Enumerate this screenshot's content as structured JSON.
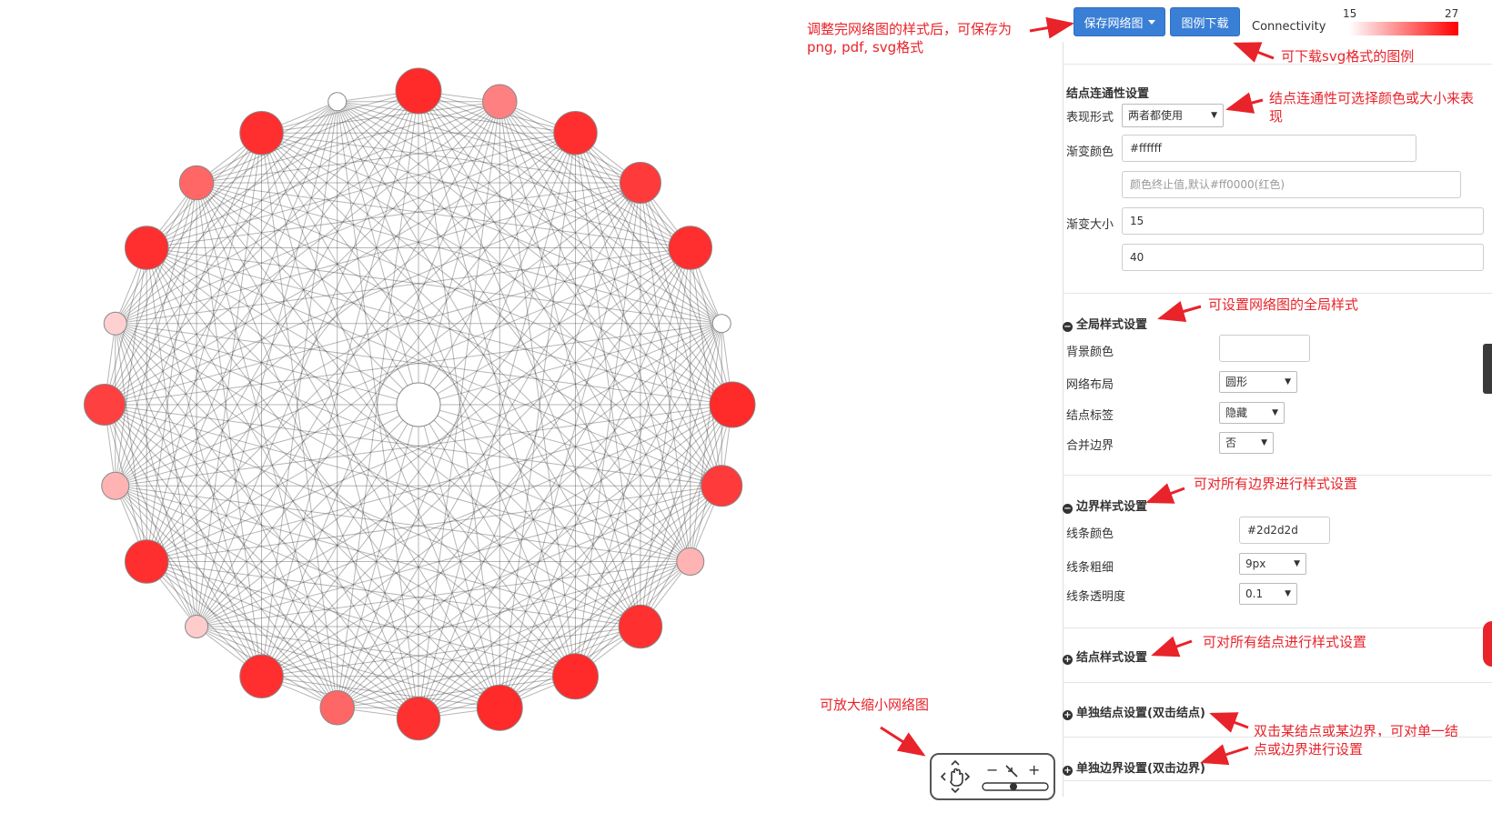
{
  "toolbar": {
    "save_label": "保存网络图",
    "legend_download_label": "图例下载",
    "connectivity_label": "Connectivity",
    "legend_min": "15",
    "legend_max": "27",
    "gradient_start": "#ffffff",
    "gradient_end": "#ff0000"
  },
  "annotations": {
    "save_note_line1": "调整完网络图的样式后，可保存为",
    "save_note_line2": "png, pdf, svg格式",
    "legend_note": "可下载svg格式的图例",
    "connectivity_note_line1": "结点连通性可选择颜色或大小来表",
    "connectivity_note_line2": "现",
    "global_note": "可设置网络图的全局样式",
    "edge_note": "可对所有边界进行样式设置",
    "node_note": "可对所有结点进行样式设置",
    "zoom_note": "可放大缩小网络图",
    "single_note_line1": "双击某结点或某边界，可对单一结",
    "single_note_line2": "点或边界进行设置"
  },
  "connectivity": {
    "title": "结点连通性设置",
    "display_label": "表现形式",
    "display_value": "两者都使用",
    "gradient_color_label": "渐变颜色",
    "color_start_value": "#ffffff",
    "color_end_placeholder": "颜色终止值,默认#ff0000(红色)",
    "gradient_size_label": "渐变大小",
    "size_min_value": "15",
    "size_max_value": "40"
  },
  "global": {
    "title": "全局样式设置",
    "bg_label": "背景颜色",
    "bg_value": "",
    "layout_label": "网络布局",
    "layout_value": "圆形",
    "node_label_label": "结点标签",
    "node_label_value": "隐藏",
    "merge_label": "合并边界",
    "merge_value": "否"
  },
  "edge": {
    "title": "边界样式设置",
    "color_label": "线条颜色",
    "color_value": "#2d2d2d",
    "width_label": "线条粗细",
    "width_value": "9px",
    "opacity_label": "线条透明度",
    "opacity_value": "0.1"
  },
  "node_section": {
    "title": "结点样式设置"
  },
  "single_node_section": {
    "title": "单独结点设置(双击结点)"
  },
  "single_edge_section": {
    "title": "单独边界设置(双击边界)"
  },
  "zoom": {
    "minus": "−",
    "plus": "+"
  },
  "network": {
    "edge_color": "#2d2d2d",
    "node_fills": [
      "#ff2a2a",
      "#ff8080",
      "#ff2f2f",
      "#ff3a3a",
      "#ff2f2f",
      "#ffffff",
      "#ff2a2a",
      "#ff3a3a",
      "#ffb3b3",
      "#ff3030",
      "#ff2a2a",
      "#ff2a2a",
      "#ff3030",
      "#ff6666",
      "#ff2f2f",
      "#ffcccc",
      "#ff2f2f",
      "#ffb3b3",
      "#ff4040",
      "#ffd0d0",
      "#ff2f2f",
      "#ff6666",
      "#ff2f2f",
      "#ffffff"
    ],
    "connectivity": [
      27,
      22,
      26,
      25,
      26,
      15,
      27,
      25,
      19,
      26,
      27,
      27,
      26,
      22,
      26,
      17,
      26,
      19,
      25,
      17,
      26,
      22,
      26,
      15
    ]
  }
}
